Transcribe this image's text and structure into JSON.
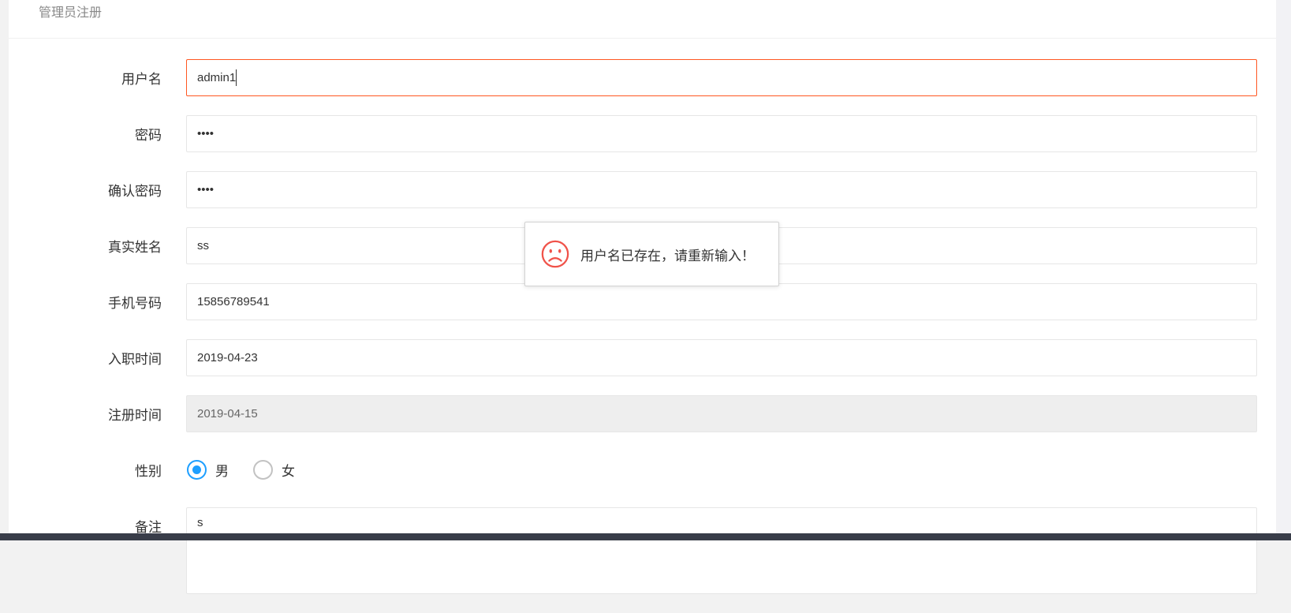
{
  "header": {
    "title": "管理员注册"
  },
  "form": {
    "username": {
      "label": "用户名",
      "value": "admin1"
    },
    "password": {
      "label": "密码",
      "value": "••••"
    },
    "confirm_password": {
      "label": "确认密码",
      "value": "••••"
    },
    "real_name": {
      "label": "真实姓名",
      "value": "ss"
    },
    "phone": {
      "label": "手机号码",
      "value": "15856789541"
    },
    "hire_date": {
      "label": "入职时间",
      "value": "2019-04-23"
    },
    "register_date": {
      "label": "注册时间",
      "value": "2019-04-15"
    },
    "gender": {
      "label": "性别",
      "options": [
        "男",
        "女"
      ],
      "selected_index": 0
    },
    "remark": {
      "label": "备注",
      "value": "s"
    }
  },
  "toast": {
    "message": "用户名已存在，请重新输入！",
    "icon": "sad-face-icon"
  },
  "colors": {
    "error_border": "#FF5722",
    "radio_checked": "#1E9FFF",
    "footer_bar": "#393D49",
    "toast_icon": "#F0534A"
  }
}
